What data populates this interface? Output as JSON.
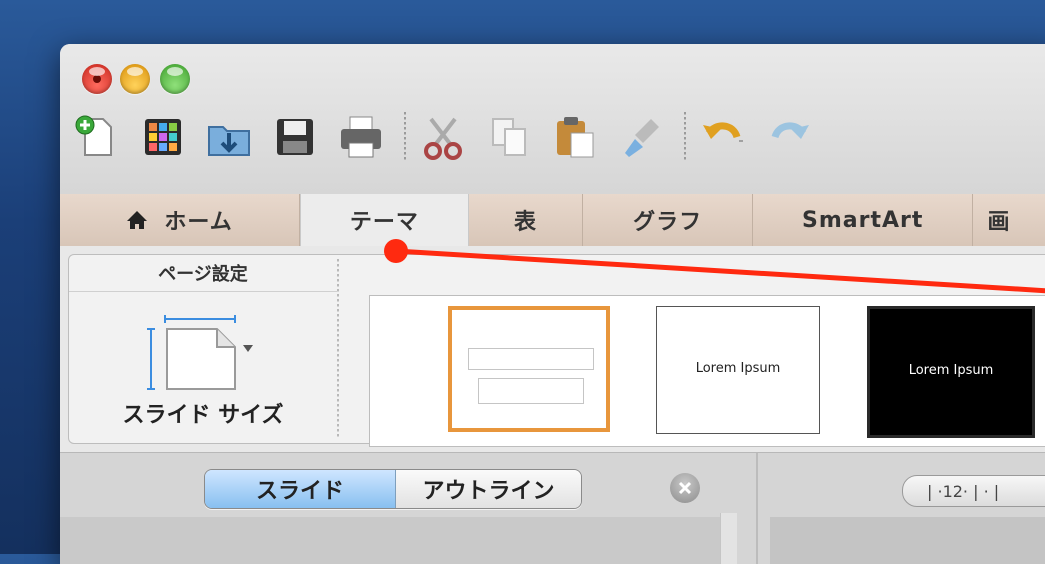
{
  "window": {
    "title": ""
  },
  "toolbar": {
    "items": [
      {
        "name": "new-document-icon"
      },
      {
        "name": "gallery-icon"
      },
      {
        "name": "open-folder-icon"
      },
      {
        "name": "save-icon"
      },
      {
        "name": "print-icon"
      },
      {
        "name": "cut-icon"
      },
      {
        "name": "copy-icon"
      },
      {
        "name": "paste-icon"
      },
      {
        "name": "format-painter-icon"
      },
      {
        "name": "undo-icon"
      },
      {
        "name": "redo-icon"
      }
    ]
  },
  "tabs": [
    {
      "label": "ホーム",
      "icon": "home-icon"
    },
    {
      "label": "テーマ",
      "active": true
    },
    {
      "label": "表"
    },
    {
      "label": "グラフ"
    },
    {
      "label": "SmartArt"
    },
    {
      "label": "画"
    }
  ],
  "ribbon": {
    "page_setup": {
      "title": "ページ設定",
      "slide_size_label": "スライド サイズ"
    },
    "themes": [
      {
        "name": "blank",
        "text": ""
      },
      {
        "name": "white",
        "text": "Lorem Ipsum"
      },
      {
        "name": "black",
        "text": "Lorem Ipsum"
      }
    ]
  },
  "pane": {
    "segment": {
      "slide": "スライド",
      "outline": "アウトライン",
      "selected": "slide"
    },
    "ruler_text": "| ·12· | · |"
  },
  "annotation": {
    "color": "#ff2a10"
  },
  "colors": {
    "accent_selected_theme": "#e8963c",
    "segment_selected": "#88c0f0"
  }
}
